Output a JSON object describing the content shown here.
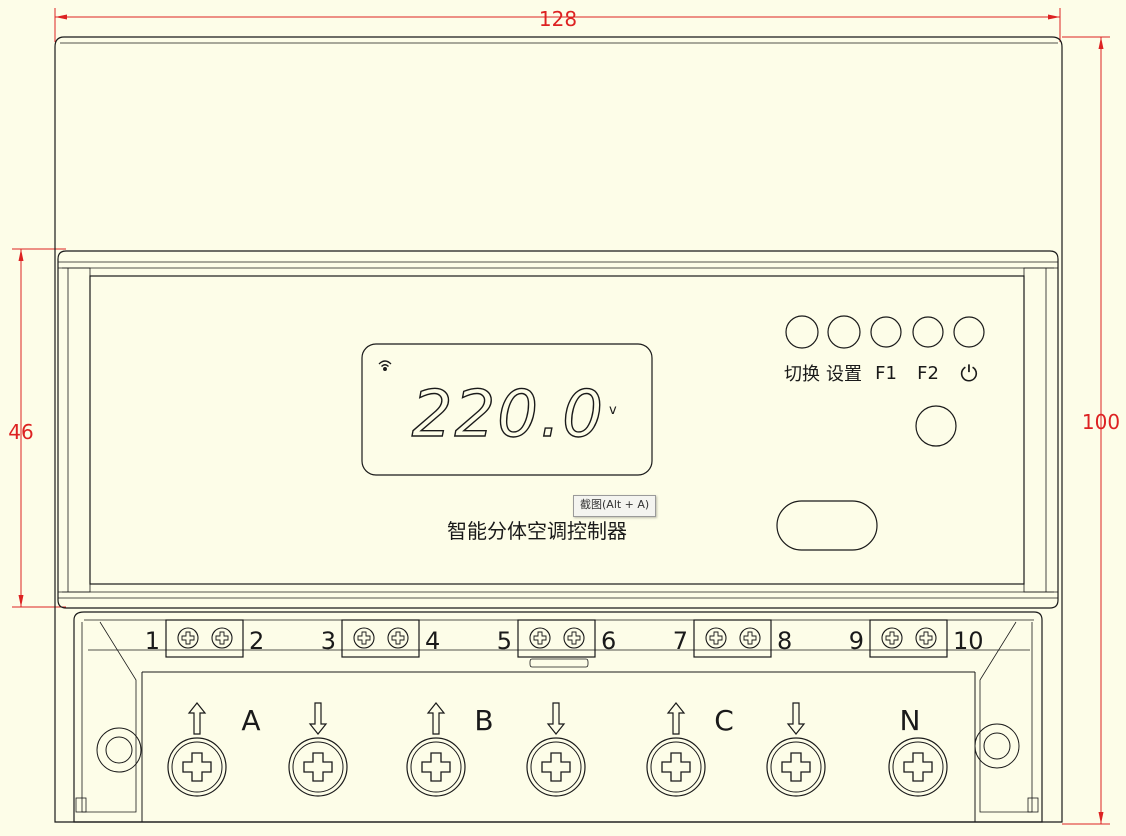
{
  "dimensions": {
    "width": "128",
    "height_total": "100",
    "height_panel": "46"
  },
  "display": {
    "reading": "220.0",
    "unit": "v"
  },
  "device": {
    "name": "智能分体空调控制器"
  },
  "buttons": [
    {
      "label": "切换"
    },
    {
      "label": "设置"
    },
    {
      "label": "F1"
    },
    {
      "label": "F2"
    },
    {
      "label": "⏻"
    }
  ],
  "terminals_small": [
    "1",
    "2",
    "3",
    "4",
    "5",
    "6",
    "7",
    "8",
    "9",
    "10"
  ],
  "terminals_large": [
    "A",
    "B",
    "C",
    "N"
  ],
  "tooltip": {
    "text": "截图(Alt + A)"
  },
  "colors": {
    "background": "#fdfde8",
    "line": "#1a1a1a",
    "dimension": "#dd2222"
  }
}
